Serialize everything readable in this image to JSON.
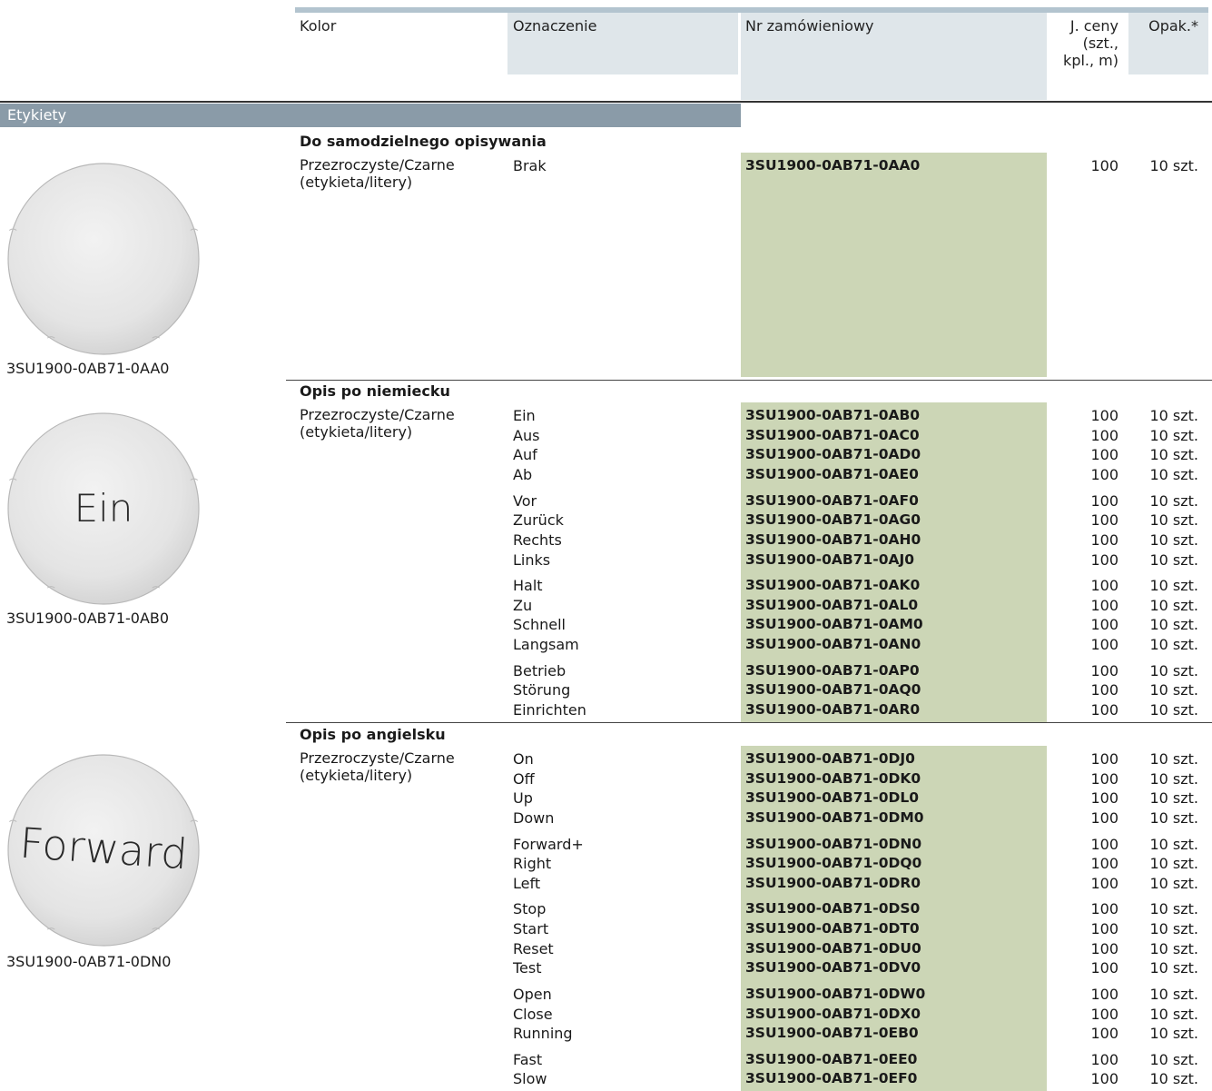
{
  "header": {
    "col_kolor": "Kolor",
    "col_oznaczenie": "Oznaczenie",
    "col_nr": "Nr zamówieniowy",
    "col_jceny": [
      "J. ceny",
      "(szt.,",
      "kpl., m)"
    ],
    "col_opak": "Opak.*"
  },
  "category": "Etykiety",
  "colors": {
    "header_bg": "#dfe6ea",
    "category_bar": "#8a9ba8",
    "order_highlight": "#ccd6b6"
  },
  "sections": [
    {
      "title": "Do samodzielnego opisywania",
      "kolor": [
        "Przezroczyste/Czarne",
        "(etykieta/litery)"
      ],
      "image_caption": "3SU1900-0AB71-0AA0",
      "image_text": "",
      "groups": [
        [
          {
            "oznaczenie": "Brak",
            "nr": "3SU1900-0AB71-0AA0",
            "jceny": "100",
            "opak": "10 szt."
          }
        ]
      ]
    },
    {
      "title": "Opis po niemiecku",
      "kolor": [
        "Przezroczyste/Czarne",
        "(etykieta/litery)"
      ],
      "image_caption": "3SU1900-0AB71-0AB0",
      "image_text": "Ein",
      "groups": [
        [
          {
            "oznaczenie": "Ein",
            "nr": "3SU1900-0AB71-0AB0",
            "jceny": "100",
            "opak": "10 szt."
          },
          {
            "oznaczenie": "Aus",
            "nr": "3SU1900-0AB71-0AC0",
            "jceny": "100",
            "opak": "10 szt."
          },
          {
            "oznaczenie": "Auf",
            "nr": "3SU1900-0AB71-0AD0",
            "jceny": "100",
            "opak": "10 szt."
          },
          {
            "oznaczenie": "Ab",
            "nr": "3SU1900-0AB71-0AE0",
            "jceny": "100",
            "opak": "10 szt."
          }
        ],
        [
          {
            "oznaczenie": "Vor",
            "nr": "3SU1900-0AB71-0AF0",
            "jceny": "100",
            "opak": "10 szt."
          },
          {
            "oznaczenie": "Zurück",
            "nr": "3SU1900-0AB71-0AG0",
            "jceny": "100",
            "opak": "10 szt."
          },
          {
            "oznaczenie": "Rechts",
            "nr": "3SU1900-0AB71-0AH0",
            "jceny": "100",
            "opak": "10 szt."
          },
          {
            "oznaczenie": "Links",
            "nr": "3SU1900-0AB71-0AJ0",
            "jceny": "100",
            "opak": "10 szt."
          }
        ],
        [
          {
            "oznaczenie": "Halt",
            "nr": "3SU1900-0AB71-0AK0",
            "jceny": "100",
            "opak": "10 szt."
          },
          {
            "oznaczenie": "Zu",
            "nr": "3SU1900-0AB71-0AL0",
            "jceny": "100",
            "opak": "10 szt."
          },
          {
            "oznaczenie": "Schnell",
            "nr": "3SU1900-0AB71-0AM0",
            "jceny": "100",
            "opak": "10 szt."
          },
          {
            "oznaczenie": "Langsam",
            "nr": "3SU1900-0AB71-0AN0",
            "jceny": "100",
            "opak": "10 szt."
          }
        ],
        [
          {
            "oznaczenie": "Betrieb",
            "nr": "3SU1900-0AB71-0AP0",
            "jceny": "100",
            "opak": "10 szt."
          },
          {
            "oznaczenie": "Störung",
            "nr": "3SU1900-0AB71-0AQ0",
            "jceny": "100",
            "opak": "10 szt."
          },
          {
            "oznaczenie": "Einrichten",
            "nr": "3SU1900-0AB71-0AR0",
            "jceny": "100",
            "opak": "10 szt."
          }
        ]
      ]
    },
    {
      "title": "Opis po angielsku",
      "kolor": [
        "Przezroczyste/Czarne",
        "(etykieta/litery)"
      ],
      "image_caption": "3SU1900-0AB71-0DN0",
      "image_text": "Forward",
      "groups": [
        [
          {
            "oznaczenie": "On",
            "nr": "3SU1900-0AB71-0DJ0",
            "jceny": "100",
            "opak": "10 szt."
          },
          {
            "oznaczenie": "Off",
            "nr": "3SU1900-0AB71-0DK0",
            "jceny": "100",
            "opak": "10 szt."
          },
          {
            "oznaczenie": "Up",
            "nr": "3SU1900-0AB71-0DL0",
            "jceny": "100",
            "opak": "10 szt."
          },
          {
            "oznaczenie": "Down",
            "nr": "3SU1900-0AB71-0DM0",
            "jceny": "100",
            "opak": "10 szt."
          }
        ],
        [
          {
            "oznaczenie": "Forward+",
            "nr": "3SU1900-0AB71-0DN0",
            "jceny": "100",
            "opak": "10 szt."
          },
          {
            "oznaczenie": "Right",
            "nr": "3SU1900-0AB71-0DQ0",
            "jceny": "100",
            "opak": "10 szt."
          },
          {
            "oznaczenie": "Left",
            "nr": "3SU1900-0AB71-0DR0",
            "jceny": "100",
            "opak": "10 szt."
          }
        ],
        [
          {
            "oznaczenie": "Stop",
            "nr": "3SU1900-0AB71-0DS0",
            "jceny": "100",
            "opak": "10 szt."
          },
          {
            "oznaczenie": "Start",
            "nr": "3SU1900-0AB71-0DT0",
            "jceny": "100",
            "opak": "10 szt."
          },
          {
            "oznaczenie": "Reset",
            "nr": "3SU1900-0AB71-0DU0",
            "jceny": "100",
            "opak": "10 szt."
          },
          {
            "oznaczenie": "Test",
            "nr": "3SU1900-0AB71-0DV0",
            "jceny": "100",
            "opak": "10 szt."
          }
        ],
        [
          {
            "oznaczenie": "Open",
            "nr": "3SU1900-0AB71-0DW0",
            "jceny": "100",
            "opak": "10 szt."
          },
          {
            "oznaczenie": "Close",
            "nr": "3SU1900-0AB71-0DX0",
            "jceny": "100",
            "opak": "10 szt."
          },
          {
            "oznaczenie": "Running",
            "nr": "3SU1900-0AB71-0EB0",
            "jceny": "100",
            "opak": "10 szt."
          }
        ],
        [
          {
            "oznaczenie": "Fast",
            "nr": "3SU1900-0AB71-0EE0",
            "jceny": "100",
            "opak": "10 szt."
          },
          {
            "oznaczenie": "Slow",
            "nr": "3SU1900-0AB71-0EF0",
            "jceny": "100",
            "opak": "10 szt."
          }
        ]
      ]
    }
  ]
}
